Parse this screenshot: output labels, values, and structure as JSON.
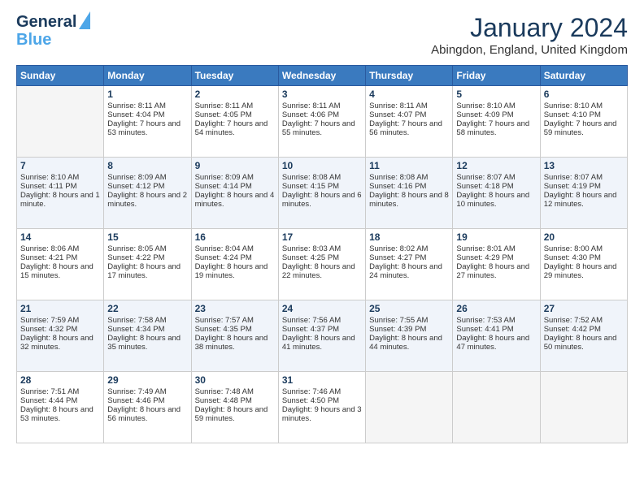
{
  "logo": {
    "line1": "General",
    "line2": "Blue"
  },
  "title": "January 2024",
  "location": "Abingdon, England, United Kingdom",
  "days_of_week": [
    "Sunday",
    "Monday",
    "Tuesday",
    "Wednesday",
    "Thursday",
    "Friday",
    "Saturday"
  ],
  "weeks": [
    [
      {
        "day": "",
        "sunrise": "",
        "sunset": "",
        "daylight": ""
      },
      {
        "day": "1",
        "sunrise": "Sunrise: 8:11 AM",
        "sunset": "Sunset: 4:04 PM",
        "daylight": "Daylight: 7 hours and 53 minutes."
      },
      {
        "day": "2",
        "sunrise": "Sunrise: 8:11 AM",
        "sunset": "Sunset: 4:05 PM",
        "daylight": "Daylight: 7 hours and 54 minutes."
      },
      {
        "day": "3",
        "sunrise": "Sunrise: 8:11 AM",
        "sunset": "Sunset: 4:06 PM",
        "daylight": "Daylight: 7 hours and 55 minutes."
      },
      {
        "day": "4",
        "sunrise": "Sunrise: 8:11 AM",
        "sunset": "Sunset: 4:07 PM",
        "daylight": "Daylight: 7 hours and 56 minutes."
      },
      {
        "day": "5",
        "sunrise": "Sunrise: 8:10 AM",
        "sunset": "Sunset: 4:09 PM",
        "daylight": "Daylight: 7 hours and 58 minutes."
      },
      {
        "day": "6",
        "sunrise": "Sunrise: 8:10 AM",
        "sunset": "Sunset: 4:10 PM",
        "daylight": "Daylight: 7 hours and 59 minutes."
      }
    ],
    [
      {
        "day": "7",
        "sunrise": "Sunrise: 8:10 AM",
        "sunset": "Sunset: 4:11 PM",
        "daylight": "Daylight: 8 hours and 1 minute."
      },
      {
        "day": "8",
        "sunrise": "Sunrise: 8:09 AM",
        "sunset": "Sunset: 4:12 PM",
        "daylight": "Daylight: 8 hours and 2 minutes."
      },
      {
        "day": "9",
        "sunrise": "Sunrise: 8:09 AM",
        "sunset": "Sunset: 4:14 PM",
        "daylight": "Daylight: 8 hours and 4 minutes."
      },
      {
        "day": "10",
        "sunrise": "Sunrise: 8:08 AM",
        "sunset": "Sunset: 4:15 PM",
        "daylight": "Daylight: 8 hours and 6 minutes."
      },
      {
        "day": "11",
        "sunrise": "Sunrise: 8:08 AM",
        "sunset": "Sunset: 4:16 PM",
        "daylight": "Daylight: 8 hours and 8 minutes."
      },
      {
        "day": "12",
        "sunrise": "Sunrise: 8:07 AM",
        "sunset": "Sunset: 4:18 PM",
        "daylight": "Daylight: 8 hours and 10 minutes."
      },
      {
        "day": "13",
        "sunrise": "Sunrise: 8:07 AM",
        "sunset": "Sunset: 4:19 PM",
        "daylight": "Daylight: 8 hours and 12 minutes."
      }
    ],
    [
      {
        "day": "14",
        "sunrise": "Sunrise: 8:06 AM",
        "sunset": "Sunset: 4:21 PM",
        "daylight": "Daylight: 8 hours and 15 minutes."
      },
      {
        "day": "15",
        "sunrise": "Sunrise: 8:05 AM",
        "sunset": "Sunset: 4:22 PM",
        "daylight": "Daylight: 8 hours and 17 minutes."
      },
      {
        "day": "16",
        "sunrise": "Sunrise: 8:04 AM",
        "sunset": "Sunset: 4:24 PM",
        "daylight": "Daylight: 8 hours and 19 minutes."
      },
      {
        "day": "17",
        "sunrise": "Sunrise: 8:03 AM",
        "sunset": "Sunset: 4:25 PM",
        "daylight": "Daylight: 8 hours and 22 minutes."
      },
      {
        "day": "18",
        "sunrise": "Sunrise: 8:02 AM",
        "sunset": "Sunset: 4:27 PM",
        "daylight": "Daylight: 8 hours and 24 minutes."
      },
      {
        "day": "19",
        "sunrise": "Sunrise: 8:01 AM",
        "sunset": "Sunset: 4:29 PM",
        "daylight": "Daylight: 8 hours and 27 minutes."
      },
      {
        "day": "20",
        "sunrise": "Sunrise: 8:00 AM",
        "sunset": "Sunset: 4:30 PM",
        "daylight": "Daylight: 8 hours and 29 minutes."
      }
    ],
    [
      {
        "day": "21",
        "sunrise": "Sunrise: 7:59 AM",
        "sunset": "Sunset: 4:32 PM",
        "daylight": "Daylight: 8 hours and 32 minutes."
      },
      {
        "day": "22",
        "sunrise": "Sunrise: 7:58 AM",
        "sunset": "Sunset: 4:34 PM",
        "daylight": "Daylight: 8 hours and 35 minutes."
      },
      {
        "day": "23",
        "sunrise": "Sunrise: 7:57 AM",
        "sunset": "Sunset: 4:35 PM",
        "daylight": "Daylight: 8 hours and 38 minutes."
      },
      {
        "day": "24",
        "sunrise": "Sunrise: 7:56 AM",
        "sunset": "Sunset: 4:37 PM",
        "daylight": "Daylight: 8 hours and 41 minutes."
      },
      {
        "day": "25",
        "sunrise": "Sunrise: 7:55 AM",
        "sunset": "Sunset: 4:39 PM",
        "daylight": "Daylight: 8 hours and 44 minutes."
      },
      {
        "day": "26",
        "sunrise": "Sunrise: 7:53 AM",
        "sunset": "Sunset: 4:41 PM",
        "daylight": "Daylight: 8 hours and 47 minutes."
      },
      {
        "day": "27",
        "sunrise": "Sunrise: 7:52 AM",
        "sunset": "Sunset: 4:42 PM",
        "daylight": "Daylight: 8 hours and 50 minutes."
      }
    ],
    [
      {
        "day": "28",
        "sunrise": "Sunrise: 7:51 AM",
        "sunset": "Sunset: 4:44 PM",
        "daylight": "Daylight: 8 hours and 53 minutes."
      },
      {
        "day": "29",
        "sunrise": "Sunrise: 7:49 AM",
        "sunset": "Sunset: 4:46 PM",
        "daylight": "Daylight: 8 hours and 56 minutes."
      },
      {
        "day": "30",
        "sunrise": "Sunrise: 7:48 AM",
        "sunset": "Sunset: 4:48 PM",
        "daylight": "Daylight: 8 hours and 59 minutes."
      },
      {
        "day": "31",
        "sunrise": "Sunrise: 7:46 AM",
        "sunset": "Sunset: 4:50 PM",
        "daylight": "Daylight: 9 hours and 3 minutes."
      },
      {
        "day": "",
        "sunrise": "",
        "sunset": "",
        "daylight": ""
      },
      {
        "day": "",
        "sunrise": "",
        "sunset": "",
        "daylight": ""
      },
      {
        "day": "",
        "sunrise": "",
        "sunset": "",
        "daylight": ""
      }
    ]
  ]
}
